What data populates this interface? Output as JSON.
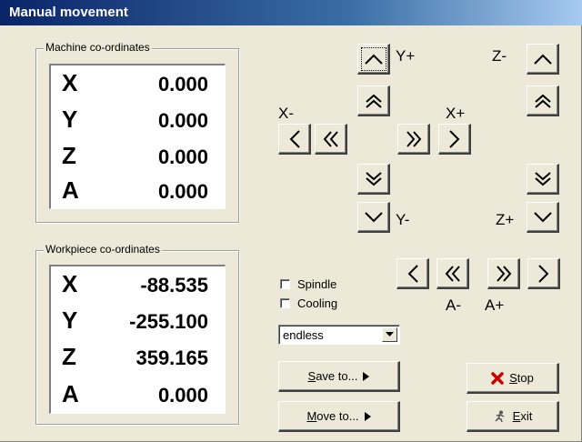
{
  "window": {
    "title": "Manual movement"
  },
  "machine": {
    "legend": "Machine co-ordinates",
    "rows": [
      {
        "axis": "X",
        "value": "0.000"
      },
      {
        "axis": "Y",
        "value": "0.000"
      },
      {
        "axis": "Z",
        "value": "0.000"
      },
      {
        "axis": "A",
        "value": "0.000"
      }
    ]
  },
  "workpiece": {
    "legend": "Workpiece co-ordinates",
    "rows": [
      {
        "axis": "X",
        "value": "-88.535"
      },
      {
        "axis": "Y",
        "value": "-255.100"
      },
      {
        "axis": "Z",
        "value": "359.165"
      },
      {
        "axis": "A",
        "value": "0.000"
      }
    ]
  },
  "jog_labels": {
    "y_plus": "Y+",
    "y_minus": "Y-",
    "x_minus": "X-",
    "x_plus": "X+",
    "z_minus": "Z-",
    "z_plus": "Z+",
    "a_minus": "A-",
    "a_plus": "A+"
  },
  "options": {
    "spindle_label": "Spindle",
    "cooling_label": "Cooling",
    "mode_value": "endless"
  },
  "buttons": {
    "save_to_first": "S",
    "save_to_rest": "ave to...",
    "move_to_first": "M",
    "move_to_rest": "ove to...",
    "stop_first": "S",
    "stop_rest": "top",
    "exit_first": "E",
    "exit_rest": "xit"
  },
  "colors": {
    "stop_icon": "#CC0000",
    "titlebar": "#0A246A"
  }
}
